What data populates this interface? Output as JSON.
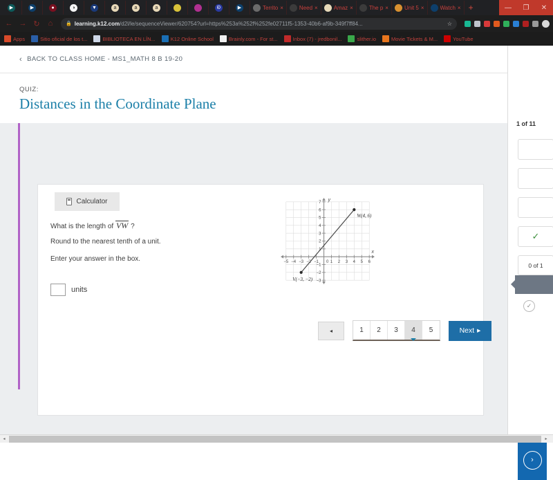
{
  "browser": {
    "pinned_tabs": [
      {
        "name": "play-circle-icon",
        "color": "#0d5a5a",
        "glyph": "▶"
      },
      {
        "name": "play-circle-icon",
        "color": "#0d3f6b",
        "glyph": "▶"
      },
      {
        "name": "record-icon",
        "color": "#7a1020",
        "glyph": "●"
      },
      {
        "name": "globe-icon",
        "color": "#f5f5f5",
        "glyph": "◑"
      },
      {
        "name": "location-pin-icon",
        "color": "#1a3a7a",
        "glyph": "▼"
      },
      {
        "name": "amazon-icon",
        "color": "#e8d9b8",
        "glyph": "a"
      },
      {
        "name": "amazon-icon",
        "color": "#e8d9b8",
        "glyph": "a"
      },
      {
        "name": "amazon-icon",
        "color": "#e8d9b8",
        "glyph": "a"
      },
      {
        "name": "book-icon",
        "color": "#d8c23a",
        "glyph": ""
      },
      {
        "name": "book-icon",
        "color": "#b03090",
        "glyph": ""
      },
      {
        "name": "brainly-icon",
        "color": "#2a3aa0",
        "glyph": "Đ"
      },
      {
        "name": "play-circle-icon",
        "color": "#0d3f6b",
        "glyph": "▶"
      }
    ],
    "tabs": [
      {
        "title": "Territo",
        "favicon": "globe-icon",
        "color": "#6b6b6b"
      },
      {
        "title": "Need",
        "favicon": "brainly-icon",
        "color": "#3b3b3b"
      },
      {
        "title": "Amaz",
        "favicon": "amazon-icon",
        "color": "#e8d9b8"
      },
      {
        "title": "The p",
        "favicon": "brainly-icon",
        "color": "#3b3b3b"
      },
      {
        "title": "Unit 5",
        "favicon": "orange-icon",
        "color": "#d89030"
      },
      {
        "title": "Watch",
        "favicon": "play-circle-icon",
        "color": "#0d3f6b"
      }
    ],
    "new_tab_label": "+",
    "close_glyph": "×",
    "window_controls": {
      "minimize": "—",
      "maximize": "❐",
      "close": "✕"
    },
    "nav": {
      "back": "←",
      "forward": "→",
      "reload": "↻",
      "home": "⌂"
    },
    "omnibox": {
      "lock": "🔒",
      "domain": "learning.k12.com",
      "path": "/d2l/le/sequenceViewer/620754?url=https%253a%252f%252fe02711f5-1353-40b6-af9b-349f7ff84...",
      "star": "☆"
    },
    "extensions": [
      {
        "name": "ext-green-icon",
        "color": "#18b893"
      },
      {
        "name": "ext-news-icon",
        "color": "#bfc4cc"
      },
      {
        "name": "ext-red-icon",
        "color": "#d83a3a"
      },
      {
        "name": "ext-orange-icon",
        "color": "#e05a1e"
      },
      {
        "name": "ext-green2-icon",
        "color": "#2faf5a"
      },
      {
        "name": "ext-blue-icon",
        "color": "#2a7fd4"
      },
      {
        "name": "ext-cast-icon",
        "color": "#b02020"
      },
      {
        "name": "ext-list-icon",
        "color": "#9a9a9a"
      },
      {
        "name": "profile-avatar-icon",
        "color": "#d8d8d8"
      }
    ],
    "bookmarks": [
      {
        "label": "Apps",
        "icon": "apps-grid-icon",
        "color": "#d84a2a"
      },
      {
        "label": "Sitio oficial de los t...",
        "icon": "jw-icon",
        "color": "#2a5fa8"
      },
      {
        "label": "BIBLIOTECA EN LÍN...",
        "icon": "library-icon",
        "color": "#cfd8e8"
      },
      {
        "label": "K12 Online School",
        "icon": "k12-icon",
        "color": "#1a6fb5"
      },
      {
        "label": "Brainly.com - For st...",
        "icon": "brainly-icon",
        "color": "#f0f0f0"
      },
      {
        "label": "Inbox (7) - jredbonil...",
        "icon": "mail-icon",
        "color": "#c02a2a"
      },
      {
        "label": "slither.io",
        "icon": "slither-icon",
        "color": "#3aa84a"
      },
      {
        "label": "Movie Tickets & M...",
        "icon": "ticket-icon",
        "color": "#e8761e"
      },
      {
        "label": "YouTube",
        "icon": "youtube-icon",
        "color": "#cc0000"
      }
    ]
  },
  "header": {
    "back_chevron": "‹",
    "back_label": "BACK TO CLASS HOME - MS1_MATH 8 B 19-20",
    "panel_toggle_name": "panel-toggle-icon"
  },
  "title": {
    "eyebrow": "QUIZ:",
    "heading": "Distances in the Coordinate Plane",
    "accent_color": "#b163c7",
    "heading_color": "#1b7fa8"
  },
  "question": {
    "calculator_label": "Calculator",
    "line1_prefix": "What is the length of",
    "segment_label": "VW",
    "line1_suffix": "?",
    "line2": "Round to the nearest tenth of a unit.",
    "line3": "Enter your answer in the box.",
    "answer_value": "",
    "answer_placeholder": "",
    "units_label": "units"
  },
  "chart_data": {
    "type": "scatter",
    "title": "",
    "xlabel": "x",
    "ylabel": "y",
    "xlim": [
      -5.8,
      6.8
    ],
    "ylim": [
      -3.6,
      7.6
    ],
    "xticks": [
      -5,
      -4,
      -3,
      -2,
      -1,
      1,
      2,
      3,
      4,
      5,
      6
    ],
    "yticks": [
      -3,
      -2,
      -1,
      1,
      2,
      3,
      4,
      5,
      6,
      7
    ],
    "origin_label": "0",
    "grid": true,
    "grid_color": "#dcdcdc",
    "axis_color": "#8c8c8c",
    "series": [
      {
        "name": "segment-VW",
        "type": "line",
        "points": [
          {
            "label": "V(−3, −2)",
            "x": -3,
            "y": -2
          },
          {
            "label": "W(4, 6)",
            "x": 4,
            "y": 6
          }
        ],
        "color": "#4a4a4a"
      }
    ],
    "annotations": [
      {
        "text": "V(−3, −2)",
        "x": -3,
        "y": -2,
        "placement": "below-left"
      },
      {
        "text": "W(4, 6)",
        "x": 4,
        "y": 6,
        "placement": "below-right"
      }
    ]
  },
  "pager": {
    "prev_glyph": "◂",
    "pages": [
      "1",
      "2",
      "3",
      "4",
      "5"
    ],
    "active_page": "4",
    "next_label": "Next",
    "next_glyph": "▸",
    "next_color": "#1e6ea7"
  },
  "rail": {
    "count_label": "1 of 11",
    "check_glyph": "✓",
    "score_label": "0 of 1",
    "circle_check_glyph": "✓",
    "next_glyph": "›",
    "next_color": "#1368b0",
    "current_color": "#6d7784"
  },
  "scrollbar": {
    "left_glyph": "◂",
    "right_glyph": "▸"
  }
}
